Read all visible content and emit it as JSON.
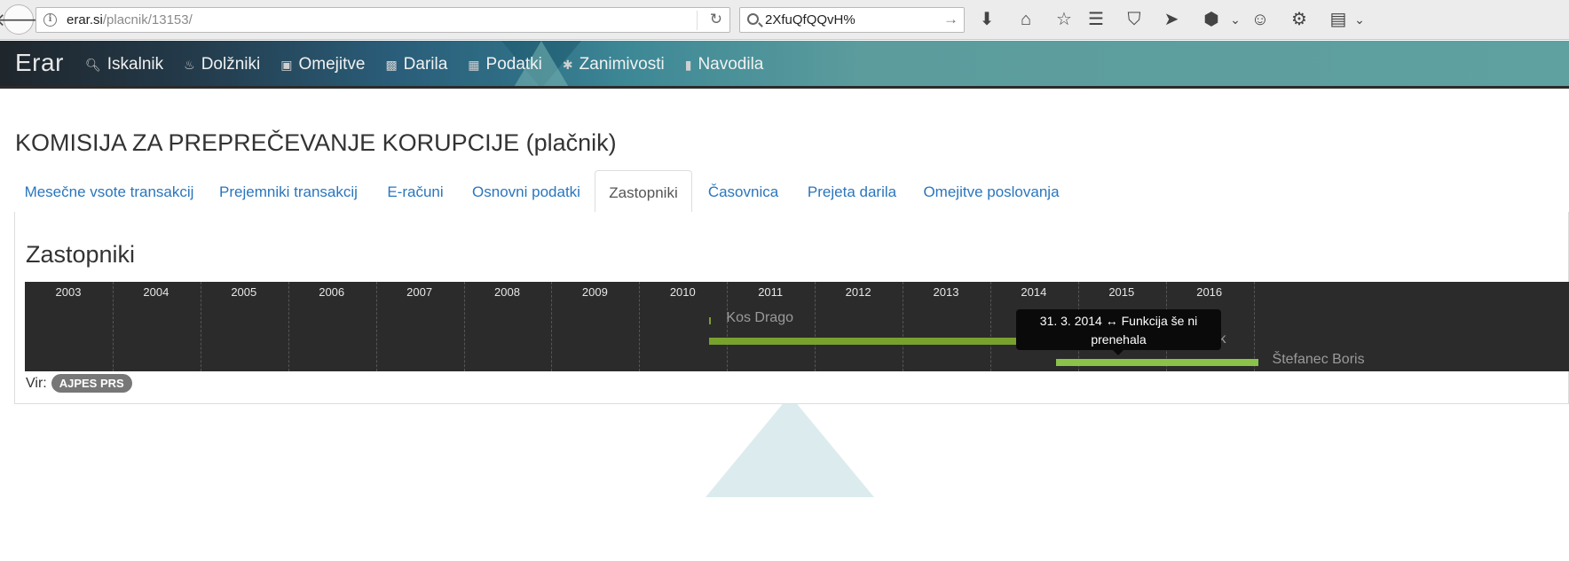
{
  "browser": {
    "url_host": "erar.si",
    "url_path": "/placnik/13153/",
    "search_text": "2XfuQfQQvH%"
  },
  "navbar": {
    "brand": "Erar",
    "items": [
      {
        "label": "Iskalnik",
        "icon": "search-icon"
      },
      {
        "label": "Dolžniki",
        "icon": "fire-icon"
      },
      {
        "label": "Omejitve",
        "icon": "briefcase-icon"
      },
      {
        "label": "Darila",
        "icon": "gift-icon"
      },
      {
        "label": "Podatki",
        "icon": "grid-icon"
      },
      {
        "label": "Zanimivosti",
        "icon": "asterisk-icon"
      },
      {
        "label": "Navodila",
        "icon": "book-icon"
      }
    ]
  },
  "page": {
    "title": "KOMISIJA ZA PREPREČEVANJE KORUPCIJE (plačnik)",
    "tabs": [
      {
        "label": "Mesečne vsote transakcij",
        "active": false
      },
      {
        "label": "Prejemniki transakcij",
        "active": false
      },
      {
        "label": "E-računi",
        "active": false
      },
      {
        "label": "Osnovni podatki",
        "active": false
      },
      {
        "label": "Zastopniki",
        "active": true
      },
      {
        "label": "Časovnica",
        "active": false
      },
      {
        "label": "Prejeta darila",
        "active": false
      },
      {
        "label": "Omejitve poslovanja",
        "active": false
      }
    ],
    "section_title": "Zastopniki",
    "source_label": "Vir:",
    "source_badge": "AJPES PRS"
  },
  "timeline": {
    "years": [
      "2003",
      "2004",
      "2005",
      "2006",
      "2007",
      "2008",
      "2009",
      "2010",
      "2011",
      "2012",
      "2013",
      "2014",
      "2015",
      "2016"
    ],
    "representatives": [
      {
        "name": "Kos Drago",
        "start": 2010.3,
        "end": 2010.31,
        "highlight": false
      },
      {
        "name": "Klemenčič Goran, zastopnik",
        "start": 2010.3,
        "end": 2014.0,
        "highlight": false
      },
      {
        "name": "Štefanec Boris",
        "start": 2014.25,
        "end": 2016.55,
        "highlight": true
      }
    ],
    "tooltip": "31. 3. 2014 ↔ Funkcija še ni prenehala",
    "colors": {
      "bar": "#79a12d",
      "bar_highlight": "#8bc24a",
      "background": "#2b2b2b"
    }
  }
}
